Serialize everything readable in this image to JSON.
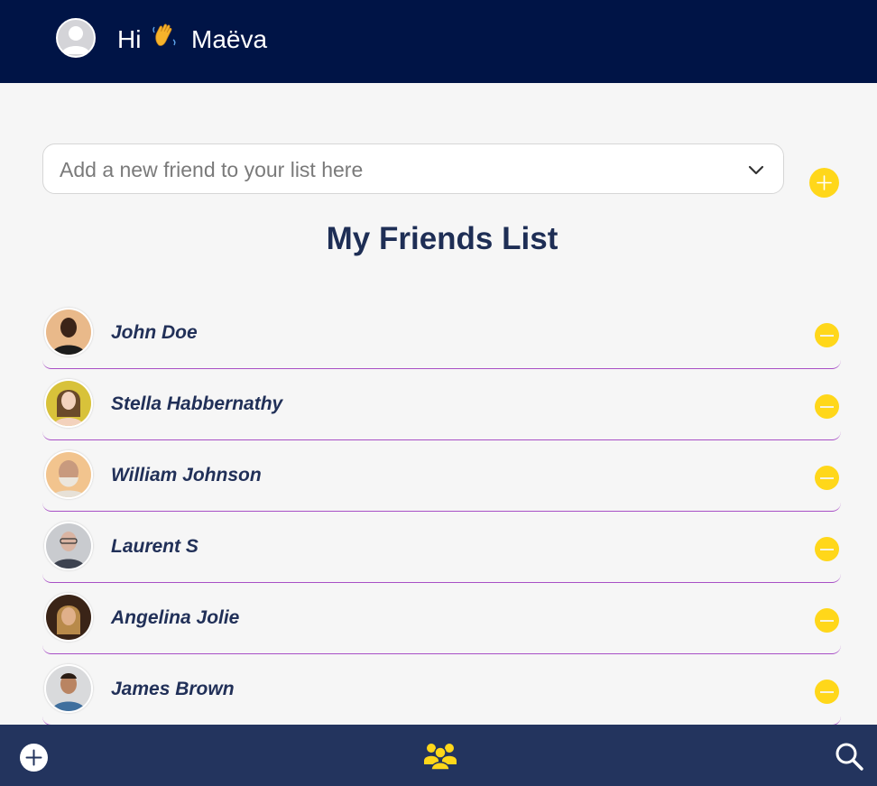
{
  "header": {
    "greeting": "Hi",
    "username": "Maëva",
    "avatar_icon": "user-avatar-icon"
  },
  "search": {
    "placeholder": "Add a new friend to your list here",
    "dropdown_icon": "chevron-down-icon",
    "add_icon": "plus-circle-icon"
  },
  "main": {
    "title": "My Friends List",
    "friends": [
      {
        "name": "John Doe",
        "avatar_bg": "#e9b98a"
      },
      {
        "name": "Stella Habbernathy",
        "avatar_bg": "#d8c23a"
      },
      {
        "name": "William Johnson",
        "avatar_bg": "#f2c48e"
      },
      {
        "name": "Laurent S",
        "avatar_bg": "#c9cbcf"
      },
      {
        "name": "Angelina Jolie",
        "avatar_bg": "#3a2417"
      },
      {
        "name": "James Brown",
        "avatar_bg": "#d9dadc"
      }
    ],
    "remove_icon": "minus-circle-icon"
  },
  "footer": {
    "icons": [
      "plus-circle-icon",
      "friends-icon",
      "search-icon"
    ]
  },
  "colors": {
    "header_bg": "#001446",
    "footer_bg": "#23345e",
    "accent": "#ffd71a",
    "title": "#1e2e55",
    "divider": "#a84fc6"
  }
}
